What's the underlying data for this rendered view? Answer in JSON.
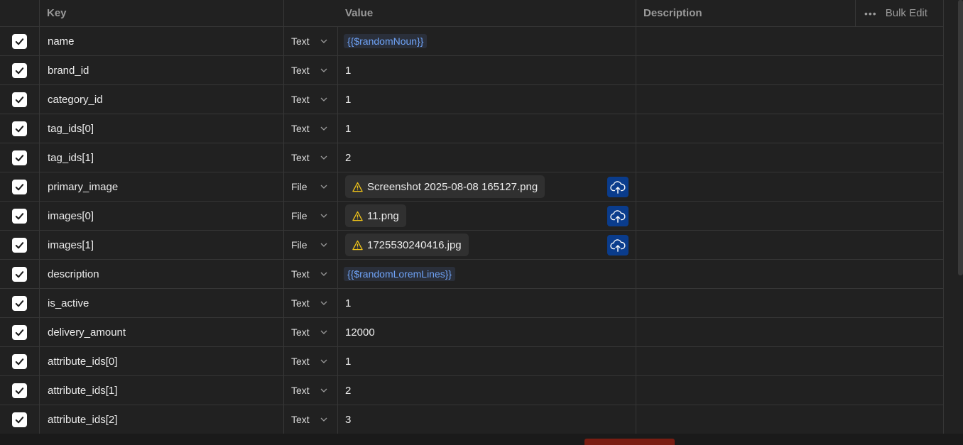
{
  "header": {
    "key": "Key",
    "value": "Value",
    "description": "Description",
    "bulk_edit": "Bulk Edit",
    "more_icon": "more-dots-icon"
  },
  "rows": [
    {
      "key": "name",
      "type": "Text",
      "value": "{{$randomNoun}}",
      "kind": "var",
      "checked": true
    },
    {
      "key": "brand_id",
      "type": "Text",
      "value": "1",
      "kind": "text",
      "checked": true
    },
    {
      "key": "category_id",
      "type": "Text",
      "value": "1",
      "kind": "text",
      "checked": true
    },
    {
      "key": "tag_ids[0]",
      "type": "Text",
      "value": "1",
      "kind": "text",
      "checked": true
    },
    {
      "key": "tag_ids[1]",
      "type": "Text",
      "value": "2",
      "kind": "text",
      "checked": true
    },
    {
      "key": "primary_image",
      "type": "File",
      "value": "Screenshot 2025-08-08 165127.png",
      "kind": "file",
      "checked": true
    },
    {
      "key": "images[0]",
      "type": "File",
      "value": "11.png",
      "kind": "file",
      "checked": true
    },
    {
      "key": "images[1]",
      "type": "File",
      "value": "1725530240416.jpg",
      "kind": "file",
      "checked": true
    },
    {
      "key": "description",
      "type": "Text",
      "value": "{{$randomLoremLines}}",
      "kind": "var",
      "checked": true
    },
    {
      "key": "is_active",
      "type": "Text",
      "value": "1",
      "kind": "text",
      "checked": true
    },
    {
      "key": "delivery_amount",
      "type": "Text",
      "value": "12000",
      "kind": "text",
      "checked": true
    },
    {
      "key": "attribute_ids[0]",
      "type": "Text",
      "value": "1",
      "kind": "text",
      "checked": true
    },
    {
      "key": "attribute_ids[1]",
      "type": "Text",
      "value": "2",
      "kind": "text",
      "checked": true
    },
    {
      "key": "attribute_ids[2]",
      "type": "Text",
      "value": "3",
      "kind": "text",
      "checked": true
    }
  ],
  "colors": {
    "background": "#212121",
    "variable": "#6fa3f7",
    "upload_button": "#0a3c8c",
    "warning": "#f0c419",
    "error_badge": "#7a1d12"
  }
}
